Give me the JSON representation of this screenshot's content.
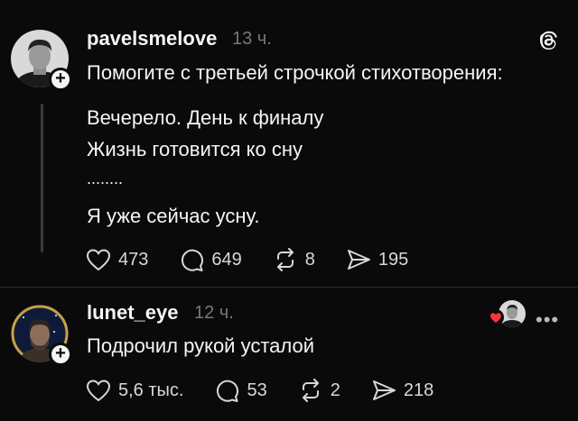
{
  "posts": [
    {
      "username": "pavelsmelove",
      "time": "13 ч.",
      "lines": [
        "Помогите с третьей строчкой стихотворения:",
        "Вечерело. День к финалу",
        "Жизнь готовится ко сну",
        "........",
        "Я уже сейчас усну."
      ],
      "likes": "473",
      "comments": "649",
      "reposts": "8",
      "shares": "195"
    },
    {
      "username": "lunet_eye",
      "time": "12 ч.",
      "lines": [
        "Подрочил рукой усталой"
      ],
      "likes": "5,6 тыс.",
      "comments": "53",
      "reposts": "2",
      "shares": "218"
    }
  ],
  "icons": {
    "like": "heart-icon",
    "comment": "comment-icon",
    "repost": "repost-icon",
    "share": "share-icon",
    "brand": "threads-logo-icon",
    "more": "more-icon"
  },
  "more_label": "•••",
  "colors": {
    "background": "#0a0a0a",
    "text": "#f3f5f7",
    "muted": "#777777",
    "liked_heart": "#ff3040"
  }
}
